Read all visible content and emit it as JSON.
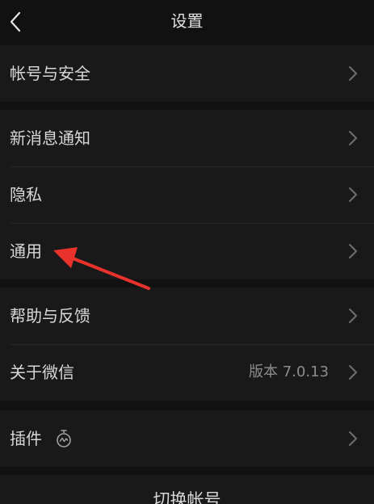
{
  "navbar": {
    "title": "设置",
    "back_icon": "chevron-left-icon"
  },
  "groups": {
    "account": {
      "items": [
        {
          "label": "帐号与安全"
        }
      ]
    },
    "general": {
      "items": [
        {
          "label": "新消息通知"
        },
        {
          "label": "隐私"
        },
        {
          "label": "通用"
        }
      ]
    },
    "about": {
      "items": [
        {
          "label": "帮助与反馈"
        },
        {
          "label": "关于微信",
          "value": "版本 7.0.13"
        }
      ]
    },
    "plugins": {
      "items": [
        {
          "label": "插件",
          "icon": "plugin-icon"
        }
      ]
    }
  },
  "bottom": {
    "switch_account_label": "切换帐号"
  },
  "annotation": {
    "type": "arrow",
    "color": "#e8322b",
    "points_to": "通用"
  }
}
